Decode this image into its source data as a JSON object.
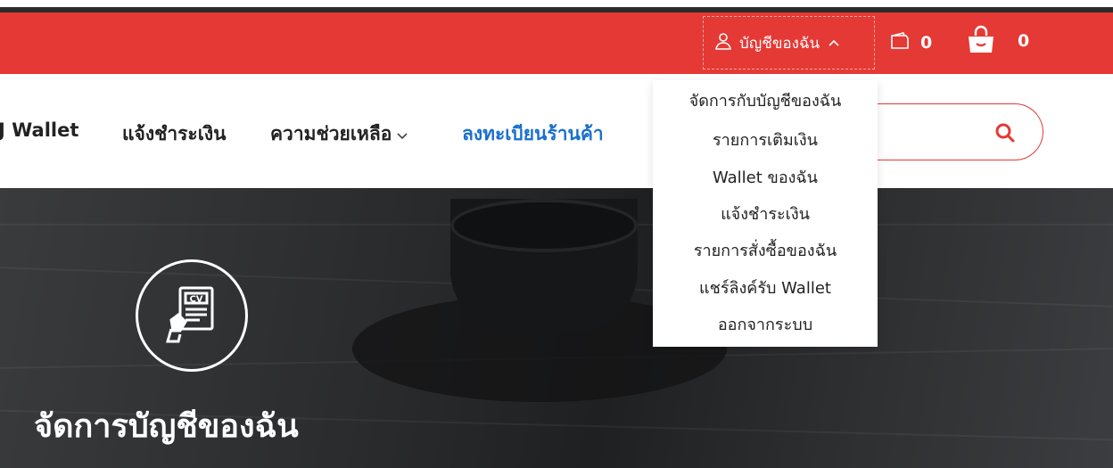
{
  "topbar": {
    "account_label": "บัญชีของฉัน",
    "wallet_count": "0",
    "cart_count": "0",
    "background": "#e53935"
  },
  "nav": {
    "items": [
      {
        "label": "J Wallet"
      },
      {
        "label": "แจ้งชำระเงิน"
      },
      {
        "label": "ความช่วยเหลือ"
      },
      {
        "label": "ลงทะเบียนร้านค้า"
      }
    ]
  },
  "account_menu": {
    "items": [
      {
        "label": "จัดการกับบัญชีของฉัน"
      },
      {
        "label": "รายการเติมเงิน"
      },
      {
        "label": "Wallet ของฉัน"
      },
      {
        "label": "แจ้งชำระเงิน"
      },
      {
        "label": "รายการสั่งซื้อของฉัน"
      },
      {
        "label": "แชร์ลิงค์รับ Wallet"
      },
      {
        "label": "ออกจากระบบ"
      }
    ]
  },
  "hero": {
    "badge_text": "CV",
    "title": "จัดการบัญชีของฉัน"
  },
  "icons": {
    "account": "user-icon",
    "wallet": "wallet-icon",
    "cart": "shopping-bag-icon",
    "search": "search-icon",
    "badge": "cv-document-icon"
  }
}
